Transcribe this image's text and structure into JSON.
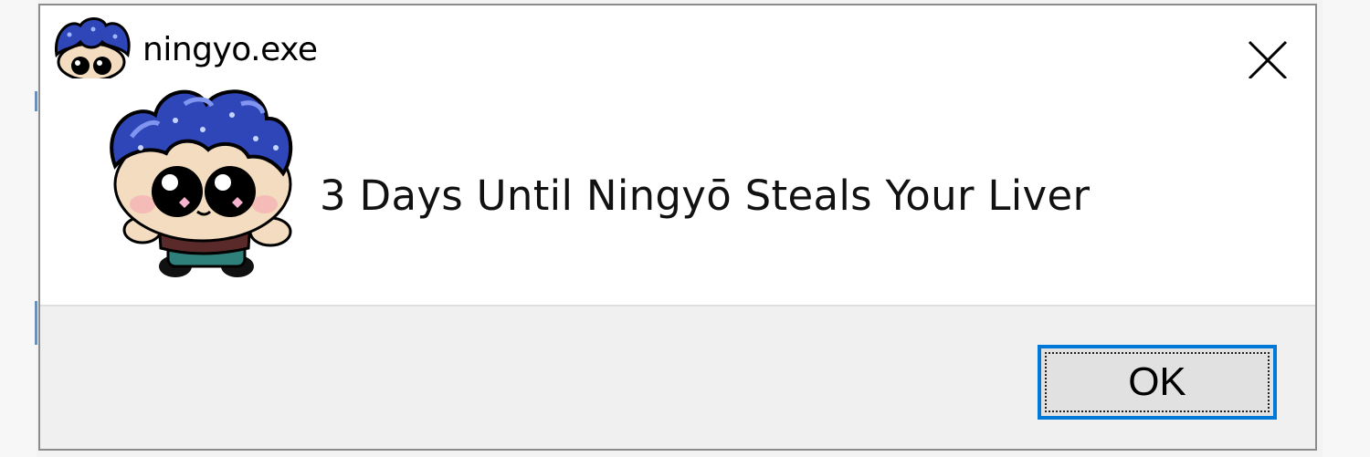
{
  "window": {
    "title": "ningyo.exe",
    "icon": "ningyo-mascot-icon",
    "close_icon": "close-icon"
  },
  "message": {
    "text": "3 Days Until Ningyō Steals Your Liver",
    "image": "ningyo-mascot-illustration"
  },
  "buttons": {
    "ok_label": "OK"
  },
  "colors": {
    "focus_border": "#0078d7",
    "footer_bg": "#f0f0f0",
    "content_bg": "#ffffff",
    "hair_blue": "#2f46b8"
  }
}
